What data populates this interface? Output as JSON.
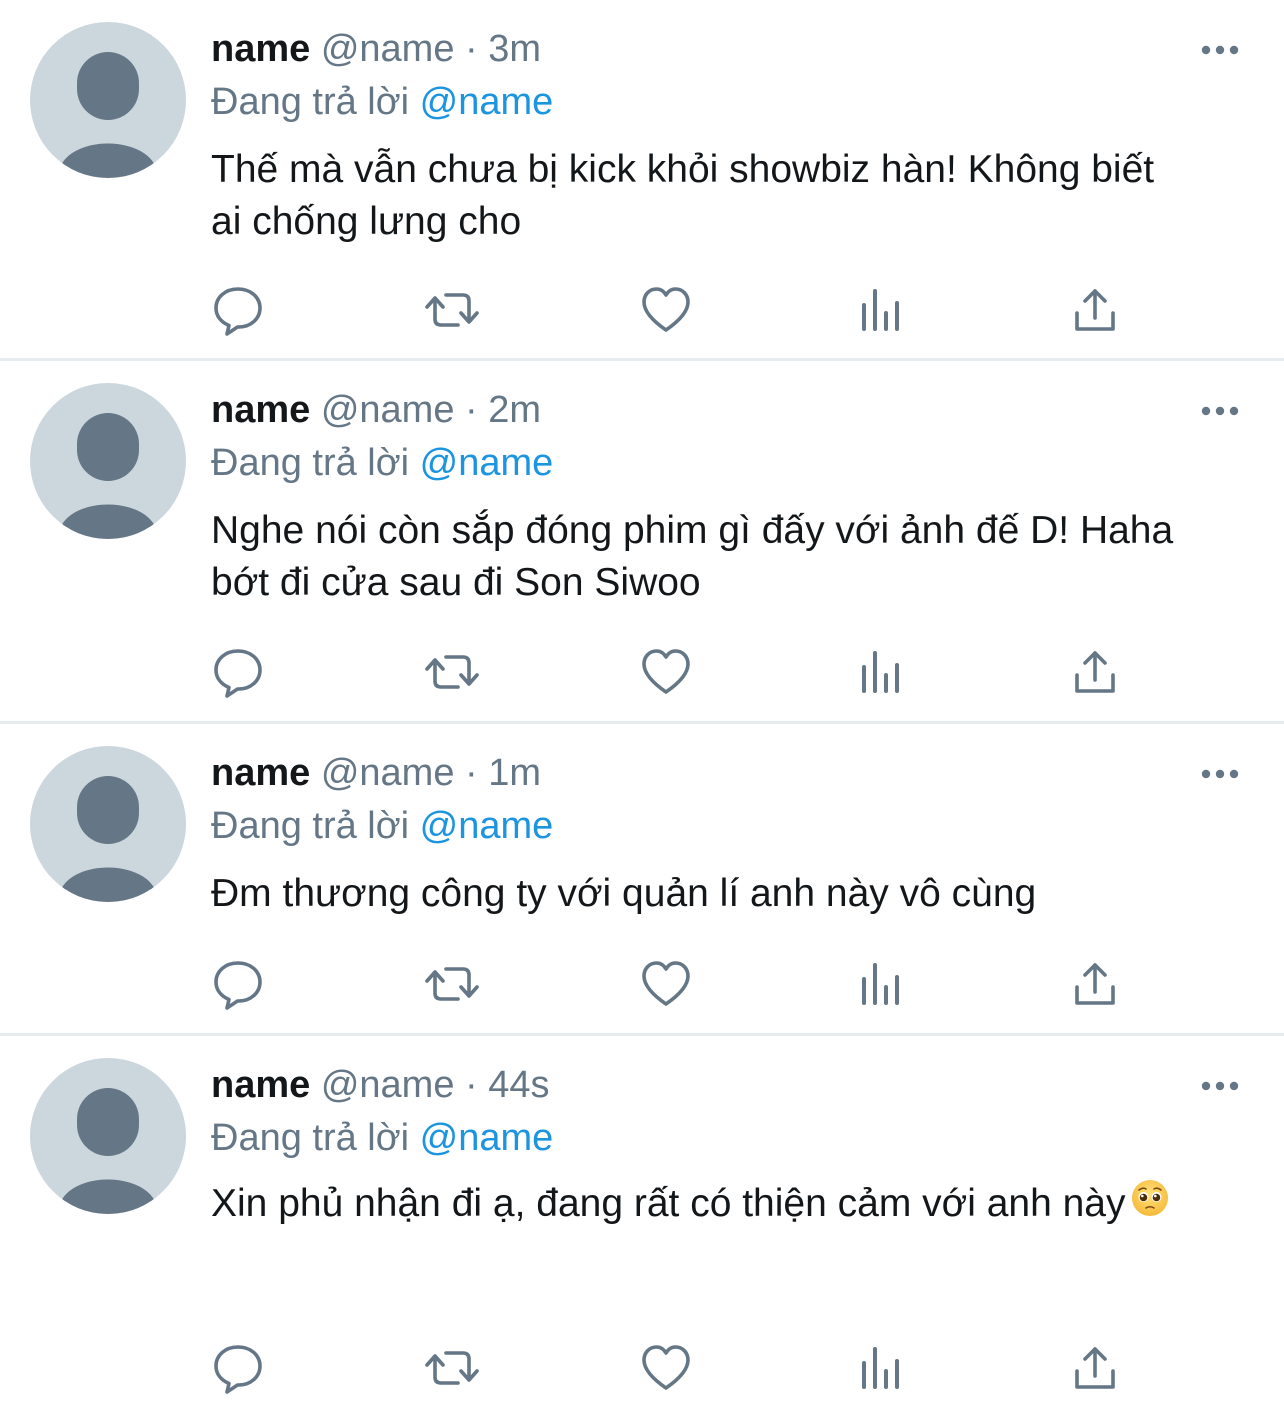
{
  "colors": {
    "text_primary": "#14171a",
    "text_secondary": "#657786",
    "link": "#1b95e0",
    "divider": "#e6ecf0",
    "avatar_bg": "#ccd6dd",
    "avatar_fg": "#657786"
  },
  "icons": {
    "more": "more-horizontal-icon",
    "reply": "reply-bubble-icon",
    "retweet": "retweet-icon",
    "like": "heart-icon",
    "stats": "bar-chart-icon",
    "share": "share-upload-icon",
    "emoji": "pleading-face-emoji"
  },
  "tweets": [
    {
      "display_name": "name",
      "handle": "@name",
      "separator": "·",
      "time": "3m",
      "reply_prefix": "Đang trả lời",
      "reply_to": "@name",
      "text": "Thế mà vẫn chưa bị kick khỏi showbiz hàn! Không biết ai chống lưng cho"
    },
    {
      "display_name": "name",
      "handle": "@name",
      "separator": "·",
      "time": "2m",
      "reply_prefix": "Đang trả lời",
      "reply_to": "@name",
      "text": "Nghe nói còn sắp đóng phim gì đấy với ảnh đế D! Haha bớt đi cửa sau đi Son Siwoo"
    },
    {
      "display_name": "name",
      "handle": "@name",
      "separator": "·",
      "time": "1m",
      "reply_prefix": "Đang trả lời",
      "reply_to": "@name",
      "text": "Đm thương công ty với quản lí anh này vô cùng"
    },
    {
      "display_name": "name",
      "handle": "@name",
      "separator": "·",
      "time": "44s",
      "reply_prefix": "Đang trả lời",
      "reply_to": "@name",
      "text": "Xin phủ nhận đi ạ, đang rất có thiện cảm với anh này"
    }
  ]
}
